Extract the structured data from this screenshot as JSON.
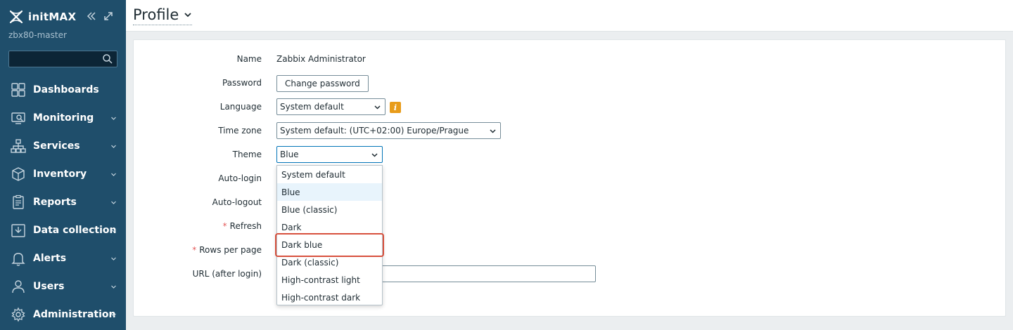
{
  "sidebar": {
    "brand": "initMAX",
    "server_name": "zbx80-master",
    "search_placeholder": "",
    "menu": [
      {
        "label": "Dashboards",
        "icon": "dashboards-icon",
        "has_chevron": false
      },
      {
        "label": "Monitoring",
        "icon": "monitoring-icon",
        "has_chevron": true
      },
      {
        "label": "Services",
        "icon": "services-icon",
        "has_chevron": true
      },
      {
        "label": "Inventory",
        "icon": "inventory-icon",
        "has_chevron": true
      },
      {
        "label": "Reports",
        "icon": "reports-icon",
        "has_chevron": true
      },
      {
        "label": "Data collection",
        "icon": "data-collection-icon",
        "has_chevron": true
      },
      {
        "label": "Alerts",
        "icon": "alerts-icon",
        "has_chevron": true
      },
      {
        "label": "Users",
        "icon": "users-icon",
        "has_chevron": true
      },
      {
        "label": "Administration",
        "icon": "administration-icon",
        "has_chevron": true
      }
    ]
  },
  "header": {
    "title": "Profile"
  },
  "form": {
    "name_label": "Name",
    "name_value": "Zabbix Administrator",
    "password_label": "Password",
    "change_password_label": "Change password",
    "language_label": "Language",
    "language_value": "System default",
    "timezone_label": "Time zone",
    "timezone_value": "System default: (UTC+02:00) Europe/Prague",
    "theme_label": "Theme",
    "theme_value": "Blue",
    "autologin_label": "Auto-login",
    "autologout_label": "Auto-logout",
    "refresh_label": "Refresh",
    "rows_per_page_label": "Rows per page",
    "url_label": "URL (after login)",
    "required_marker": "*"
  },
  "theme_dropdown": {
    "options": [
      "System default",
      "Blue",
      "Blue (classic)",
      "Dark",
      "Dark blue",
      "Dark (classic)",
      "High-contrast light",
      "High-contrast dark"
    ],
    "selected": "Blue",
    "highlighted": "Dark blue"
  },
  "colors": {
    "sidebar_bg": "#1f4e6b",
    "accent": "#0275b8",
    "highlight_box": "#d7503d",
    "info_icon": "#e89c1a"
  }
}
